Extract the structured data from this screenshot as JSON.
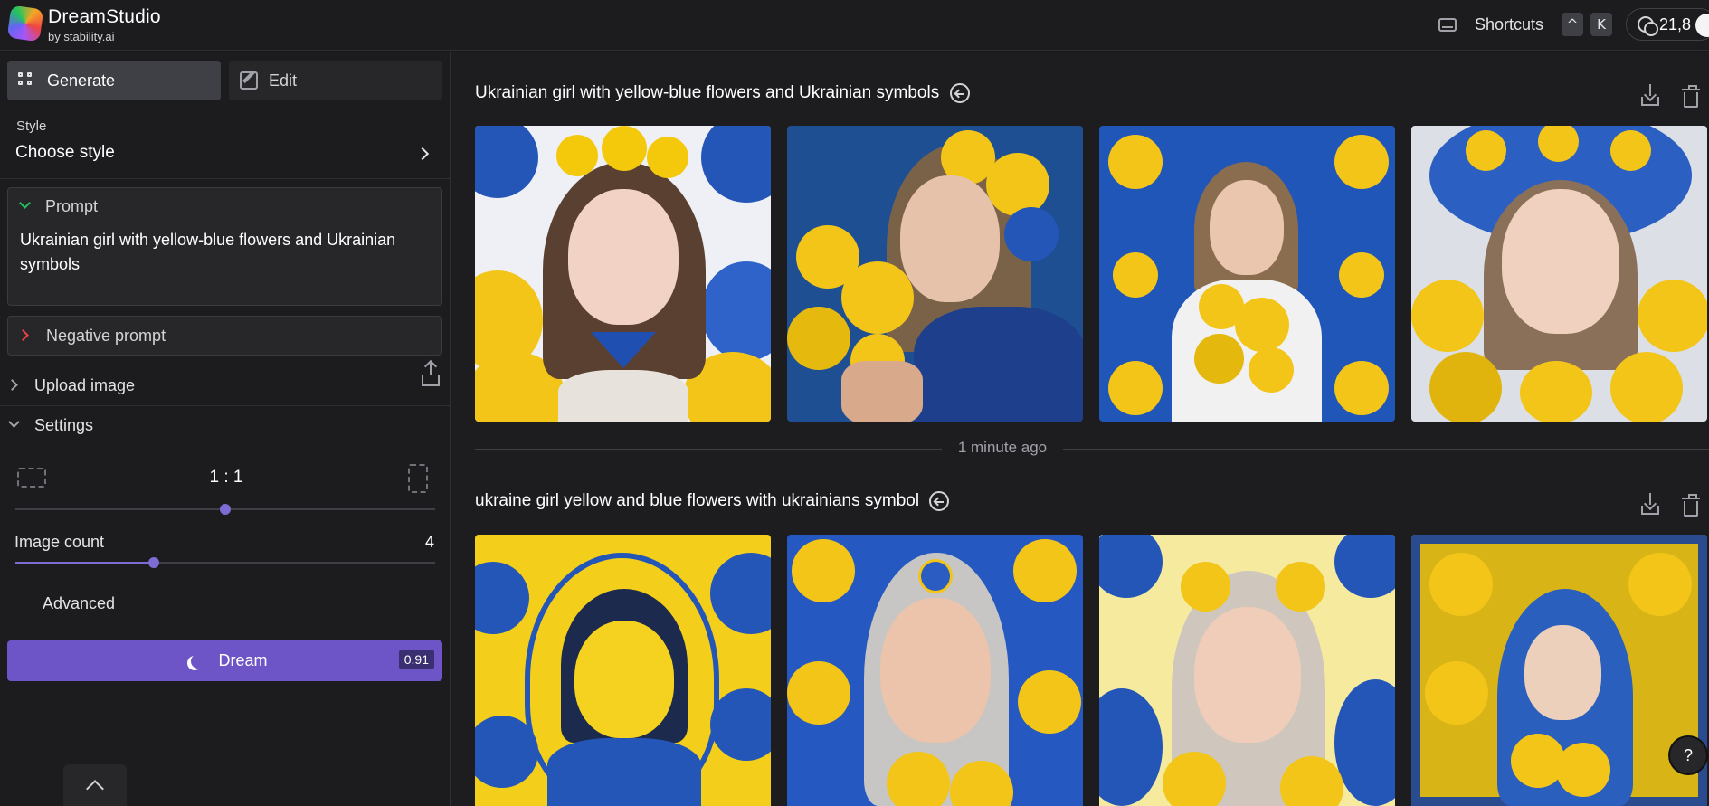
{
  "app": {
    "name": "DreamStudio",
    "byline": "by stability.ai"
  },
  "topbar": {
    "shortcuts_label": "Shortcuts",
    "keys": [
      "^",
      "K"
    ],
    "credits": "21,8"
  },
  "sidebar": {
    "tabs": [
      {
        "label": "Generate",
        "active": true
      },
      {
        "label": "Edit",
        "active": false
      }
    ],
    "style": {
      "label": "Style",
      "value": "Choose style"
    },
    "prompt": {
      "label": "Prompt",
      "text": "Ukrainian girl with yellow-blue flowers and Ukrainian symbols"
    },
    "negative_prompt_label": "Negative prompt",
    "upload_label": "Upload image",
    "settings_label": "Settings",
    "aspect_ratio": {
      "value": "1 : 1",
      "position": 0.5
    },
    "image_count": {
      "label": "Image count",
      "value": "4",
      "position": 0.33
    },
    "advanced_label": "Advanced",
    "dream": {
      "label": "Dream",
      "cost": "0.91"
    }
  },
  "main": {
    "generations": [
      {
        "prompt": "Ukrainian girl with yellow-blue flowers and Ukrainian symbols",
        "image_count": 4
      },
      {
        "prompt": "ukraine girl yellow and blue flowers with ukrainians symbol",
        "image_count": 4
      }
    ],
    "separator_time": "1 minute ago",
    "help_label": "?"
  },
  "colors": {
    "accent": "#6d55c7",
    "flower_yellow": "#f2c518",
    "flower_blue": "#2456b8"
  }
}
